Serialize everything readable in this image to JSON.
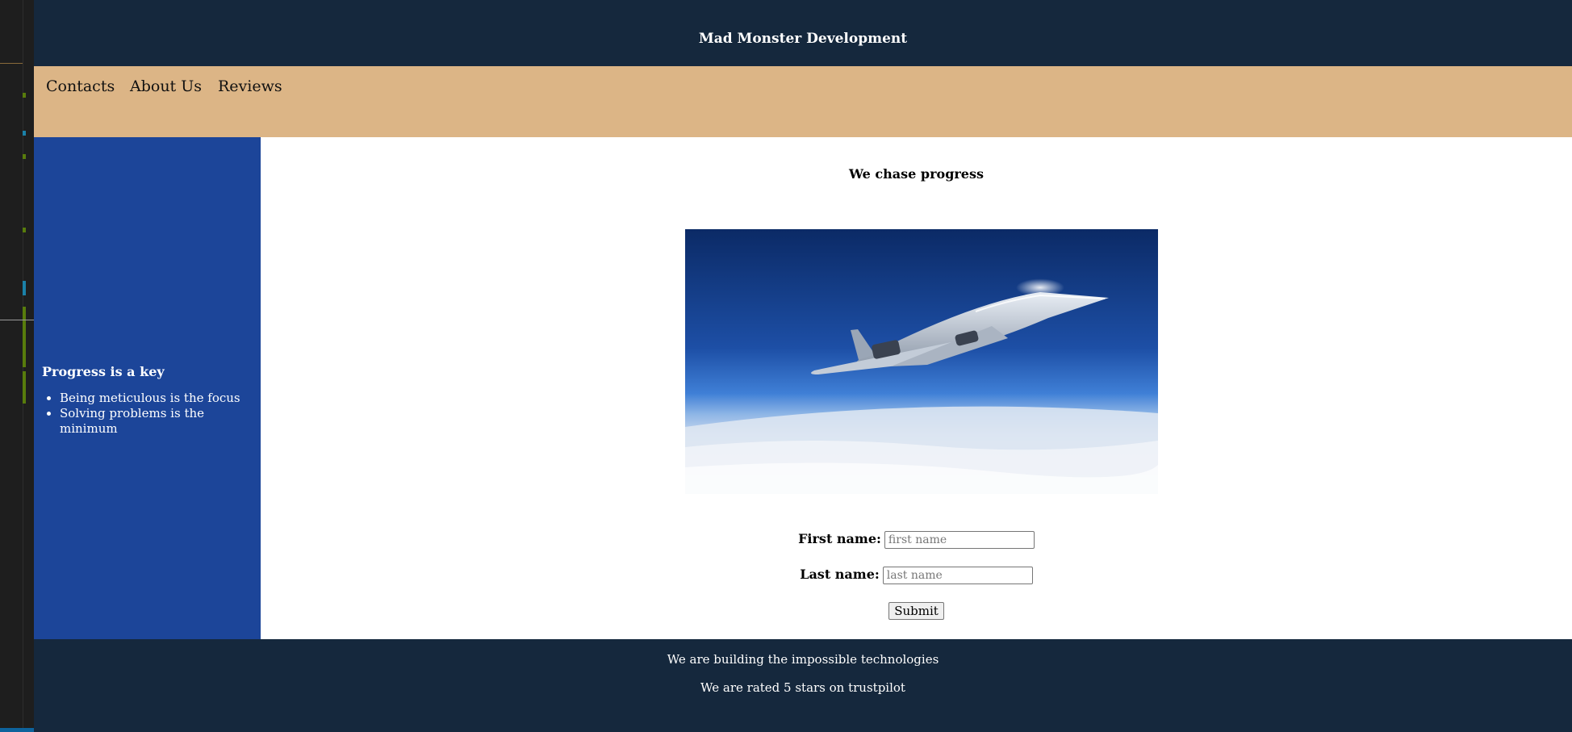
{
  "header": {
    "title": "Mad Monster Development"
  },
  "nav": {
    "items": [
      {
        "label": "Contacts"
      },
      {
        "label": "About Us"
      },
      {
        "label": "Reviews"
      }
    ]
  },
  "sidebar": {
    "heading": "Progress is a key",
    "items": [
      "Being meticulous is the focus",
      "Solving problems is the minimum"
    ]
  },
  "main": {
    "heading": "We chase progress",
    "form": {
      "first_name_label": "First name:",
      "first_name_placeholder": "first name",
      "first_name_value": "",
      "last_name_label": "Last name:",
      "last_name_placeholder": "last name",
      "last_name_value": "",
      "submit_label": "Submit"
    }
  },
  "footer": {
    "line1": "We are building the impossible technologies",
    "line2": "We are rated 5 stars on trustpilot"
  },
  "colors": {
    "header_bg": "#15283d",
    "nav_bg": "#dcb586",
    "sidebar_bg": "#1c4599",
    "footer_bg": "#15283d",
    "main_bg": "#ffffff"
  },
  "icons": {
    "hero_image": "supersonic-jet-image"
  }
}
